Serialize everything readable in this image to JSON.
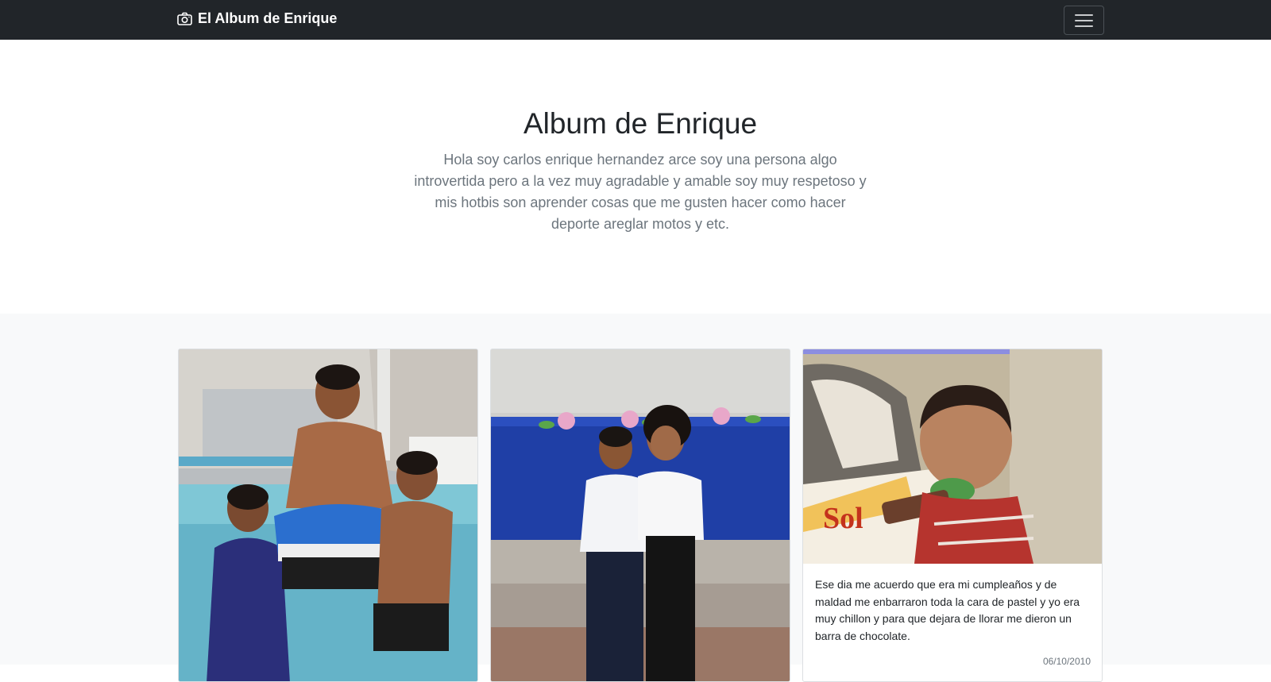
{
  "navbar": {
    "brand": "El Album de Enrique",
    "brand_icon": "camera-icon",
    "toggler_icon": "hamburger-icon"
  },
  "hero": {
    "title": "Album de Enrique",
    "lead": "Hola soy carlos enrique hernandez arce soy una persona algo introvertida pero a la vez muy agradable y amable soy muy respetoso y mis hotbis son aprender cosas que me gusten hacer como hacer deporte areglar motos y etc."
  },
  "cards": [
    {
      "photo": "pool-photo"
    },
    {
      "photo": "school-photo"
    },
    {
      "photo": "birthday-photo",
      "text": "Ese dia me acuerdo que era mi cumpleaños y de maldad me enbarraron toda la cara de pastel y yo era muy chillon y para que dejara de llorar me dieron un barra de chocolate.",
      "date": "06/10/2010"
    }
  ],
  "colors": {
    "navbar_bg": "#212529",
    "album_bg": "#f8f9fa",
    "muted_text": "#6c757d"
  }
}
